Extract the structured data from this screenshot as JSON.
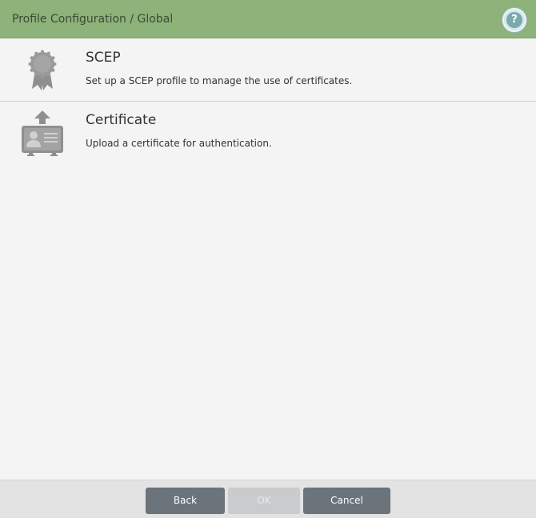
{
  "header": {
    "title": "Profile Configuration / Global",
    "help_label": "?"
  },
  "options": [
    {
      "title": "SCEP",
      "description": "Set up a SCEP profile to manage the use of certificates.",
      "icon": "award-ribbon-icon"
    },
    {
      "title": "Certificate",
      "description": "Upload a certificate for authentication.",
      "icon": "certificate-upload-icon"
    }
  ],
  "footer": {
    "back_label": "Back",
    "ok_label": "OK",
    "cancel_label": "Cancel",
    "ok_disabled": true
  },
  "colors": {
    "header_bg": "#8db27a",
    "body_bg": "#f4f4f4",
    "button_bg": "#6b737b",
    "button_disabled_bg": "#c9cbcd",
    "icon_gray": "#8f8f8f"
  }
}
